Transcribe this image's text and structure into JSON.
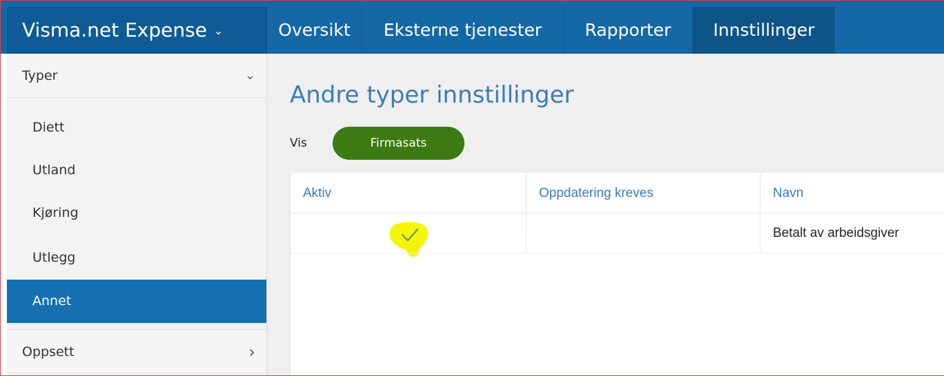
{
  "app": {
    "title": "Visma.net Expense",
    "title_chevron": "⌄"
  },
  "nav": {
    "tabs": [
      {
        "label": "Oversikt",
        "active": false
      },
      {
        "label": "Eksterne tjenester",
        "active": false
      },
      {
        "label": "Rapporter",
        "active": false
      },
      {
        "label": "Innstillinger",
        "active": true
      }
    ]
  },
  "sidebar": {
    "group_types": {
      "label": "Typer",
      "caret": "⌄",
      "expanded": true
    },
    "items": [
      {
        "label": "Diett",
        "active": false
      },
      {
        "label": "Utland",
        "active": false
      },
      {
        "label": "Kjøring",
        "active": false
      },
      {
        "label": "Utlegg",
        "active": false
      },
      {
        "label": "Annet",
        "active": true
      }
    ],
    "group_setup": {
      "label": "Oppsett",
      "caret": "›",
      "expanded": false
    }
  },
  "main": {
    "title": "Andre typer innstillinger",
    "filter_label": "Vis",
    "filter_pill": "Firmasats",
    "table": {
      "columns": [
        "Aktiv",
        "Oppdatering kreves",
        "Navn"
      ],
      "rows": [
        {
          "aktiv": true,
          "oppdatering_kreves": "",
          "navn": "Betalt av arbeidsgiver"
        }
      ]
    }
  },
  "colors": {
    "topbar": "#1568a6",
    "active_tab": "#0e5487",
    "sidebar_active": "#1470b1",
    "pill": "#3d7a12",
    "title_blue": "#3a7db5",
    "highlight": "#f5f50a",
    "check": "#6aa84f"
  },
  "icons": {
    "check": "check-icon",
    "title_chevron": "chevron-down-icon",
    "types_caret": "chevron-down-icon",
    "setup_caret": "chevron-right-icon"
  }
}
